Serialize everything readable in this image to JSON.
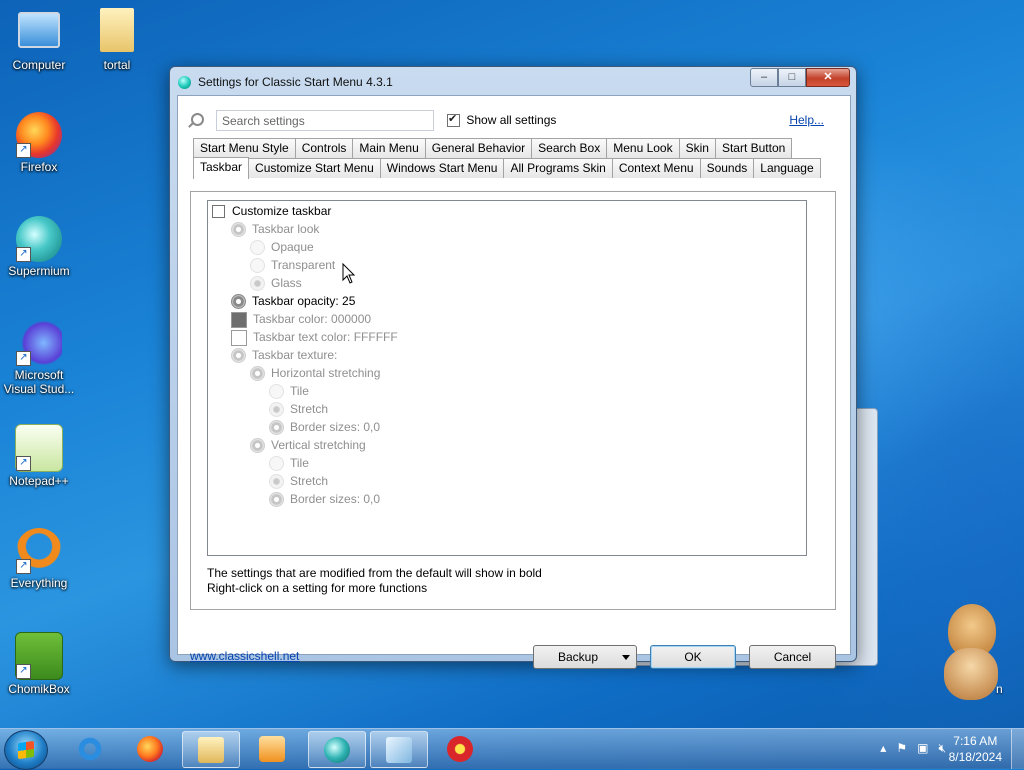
{
  "desktop": {
    "icons": [
      {
        "label": "Computer"
      },
      {
        "label": "tortal"
      },
      {
        "label": "Firefox"
      },
      {
        "label": "Supermium"
      },
      {
        "label": "Microsoft Visual Stud..."
      },
      {
        "label": "Notepad++"
      },
      {
        "label": "Everything"
      },
      {
        "label": "ChomikBox"
      }
    ],
    "mascot_suffix": "n"
  },
  "window": {
    "title": "Settings for Classic Start Menu 4.3.1",
    "buttons": {
      "minimize": "–",
      "maximize": "□",
      "close": "✕"
    }
  },
  "search": {
    "placeholder": "Search settings"
  },
  "show_all": {
    "label": "Show all settings",
    "checked": true
  },
  "help_link": "Help...",
  "tabs_row1": [
    "Start Menu Style",
    "Controls",
    "Main Menu",
    "General Behavior",
    "Search Box",
    "Menu Look",
    "Skin",
    "Start Button"
  ],
  "tabs_row2": [
    "Taskbar",
    "Customize Start Menu",
    "Windows Start Menu",
    "All Programs Skin",
    "Context Menu",
    "Sounds",
    "Language"
  ],
  "active_tab": "Taskbar",
  "tree": [
    {
      "label": "Customize taskbar",
      "kind": "checkbox"
    },
    {
      "label": "Taskbar look",
      "kind": "gear"
    },
    {
      "label": "Opaque",
      "kind": "radio"
    },
    {
      "label": "Transparent",
      "kind": "radio"
    },
    {
      "label": "Glass",
      "kind": "radio"
    },
    {
      "label": "Taskbar opacity: 25",
      "kind": "gear"
    },
    {
      "label": "Taskbar color: 000000",
      "kind": "color",
      "color": "#6e6e6e"
    },
    {
      "label": "Taskbar text color: FFFFFF",
      "kind": "color",
      "color": "#ffffff"
    },
    {
      "label": "Taskbar texture:",
      "kind": "gear"
    },
    {
      "label": "Horizontal stretching",
      "kind": "gear"
    },
    {
      "label": "Tile",
      "kind": "radio"
    },
    {
      "label": "Stretch",
      "kind": "radio"
    },
    {
      "label": "Border sizes: 0,0",
      "kind": "gear"
    },
    {
      "label": "Vertical stretching",
      "kind": "gear"
    },
    {
      "label": "Tile",
      "kind": "radio"
    },
    {
      "label": "Stretch",
      "kind": "radio"
    },
    {
      "label": "Border sizes: 0,0",
      "kind": "gear"
    }
  ],
  "status_text": {
    "line1": "The settings that are modified from the default will show in bold",
    "line2": "Right-click on a setting for more functions"
  },
  "footer": {
    "link": "www.classicshell.net",
    "backup": "Backup",
    "ok": "OK",
    "cancel": "Cancel"
  },
  "taskbar": {
    "clock_time": "7:16 AM",
    "clock_date": "8/18/2024",
    "tray_arrow": "▴"
  }
}
